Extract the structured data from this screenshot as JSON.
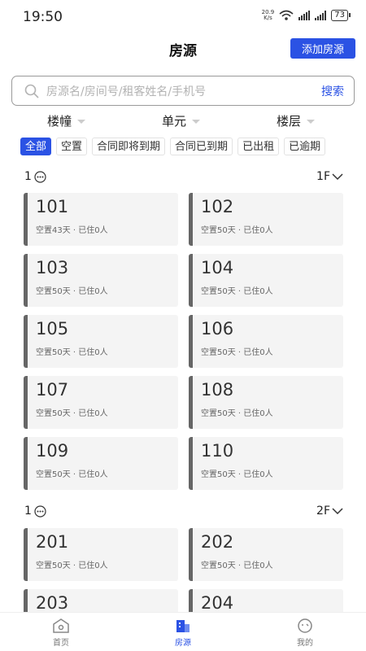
{
  "status_bar": {
    "time": "19:50",
    "net_speed_value": "20.9",
    "net_speed_unit": "K/s",
    "battery": "73"
  },
  "header": {
    "title": "房源",
    "add_button": "添加房源"
  },
  "search": {
    "placeholder": "房源名/房间号/租客姓名/手机号",
    "button": "搜索"
  },
  "filters": [
    {
      "label": "楼幢"
    },
    {
      "label": "单元"
    },
    {
      "label": "楼层"
    }
  ],
  "chips": [
    {
      "label": "全部",
      "active": true
    },
    {
      "label": "空置",
      "active": false
    },
    {
      "label": "合同即将到期",
      "active": false
    },
    {
      "label": "合同已到期",
      "active": false
    },
    {
      "label": "已出租",
      "active": false
    },
    {
      "label": "已逾期",
      "active": false
    }
  ],
  "groups": [
    {
      "label": "1",
      "floor": "1F",
      "rooms": [
        {
          "number": "101",
          "status": "空置43天 · 已住0人"
        },
        {
          "number": "102",
          "status": "空置50天 · 已住0人"
        },
        {
          "number": "103",
          "status": "空置50天 · 已住0人"
        },
        {
          "number": "104",
          "status": "空置50天 · 已住0人"
        },
        {
          "number": "105",
          "status": "空置50天 · 已住0人"
        },
        {
          "number": "106",
          "status": "空置50天 · 已住0人"
        },
        {
          "number": "107",
          "status": "空置50天 · 已住0人"
        },
        {
          "number": "108",
          "status": "空置50天 · 已住0人"
        },
        {
          "number": "109",
          "status": "空置50天 · 已住0人"
        },
        {
          "number": "110",
          "status": "空置50天 · 已住0人"
        }
      ]
    },
    {
      "label": "1",
      "floor": "2F",
      "rooms": [
        {
          "number": "201",
          "status": "空置50天 · 已住0人"
        },
        {
          "number": "202",
          "status": "空置50天 · 已住0人"
        },
        {
          "number": "203",
          "status": ""
        },
        {
          "number": "204",
          "status": ""
        }
      ]
    }
  ],
  "bottom_nav": [
    {
      "label": "首页",
      "icon": "home-icon",
      "active": false
    },
    {
      "label": "房源",
      "icon": "building-icon",
      "active": true
    },
    {
      "label": "我的",
      "icon": "profile-icon",
      "active": false
    }
  ],
  "colors": {
    "accent": "#2b52e4",
    "card_bg": "#f4f4f4",
    "card_border": "#666666"
  }
}
